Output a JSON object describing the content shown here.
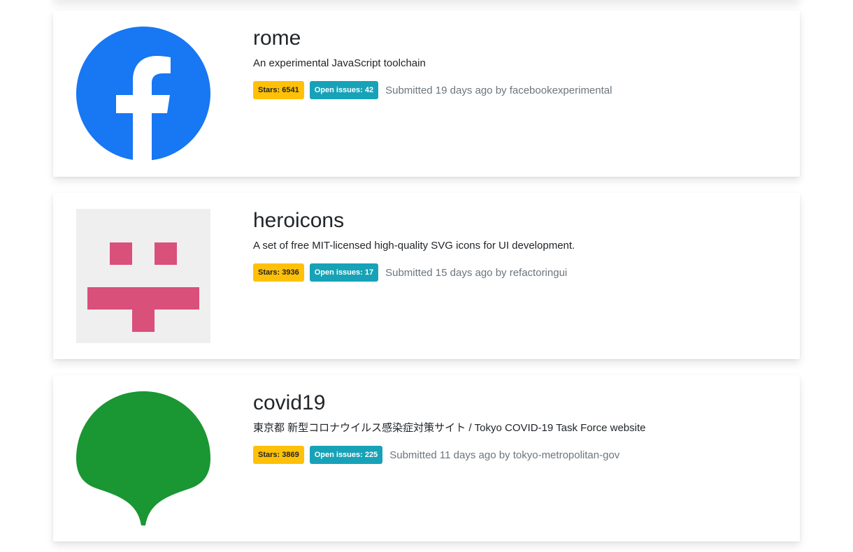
{
  "repos": [
    {
      "name": "rome",
      "description": "An experimental JavaScript toolchain",
      "stars_label": "Stars: 6541",
      "issues_label": "Open issues: 42",
      "submitted": "Submitted 19 days ago by facebookexperimental",
      "avatar_icon": "facebook-logo-icon"
    },
    {
      "name": "heroicons",
      "description": "A set of free MIT-licensed high-quality SVG icons for UI development.",
      "stars_label": "Stars: 3936",
      "issues_label": "Open issues: 17",
      "submitted": "Submitted 15 days ago by refactoringui",
      "avatar_icon": "identicon-icon"
    },
    {
      "name": "covid19",
      "description": "東京都 新型コロナウイルス感染症対策サイト / Tokyo COVID-19 Task Force website",
      "stars_label": "Stars: 3869",
      "issues_label": "Open issues: 225",
      "submitted": "Submitted 11 days ago by tokyo-metropolitan-gov",
      "avatar_icon": "tokyo-ginkgo-logo-icon"
    }
  ],
  "colors": {
    "stars_badge": "#ffc107",
    "issues_badge": "#17a2b8",
    "facebook_blue": "#1877f2",
    "identicon_pink": "#d9507b",
    "tokyo_green": "#1a9632"
  }
}
